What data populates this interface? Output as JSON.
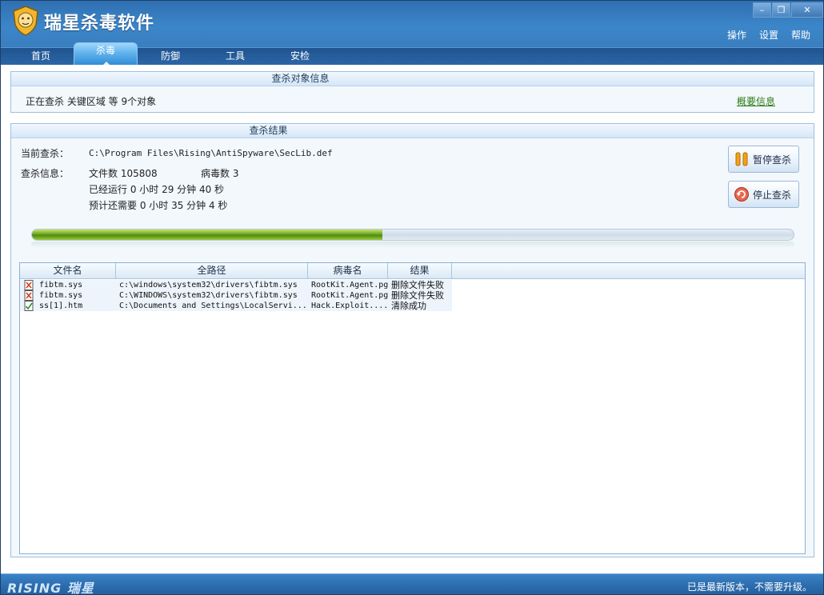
{
  "app": {
    "title": "瑞星杀毒软件"
  },
  "top_menu": {
    "ops": "操作",
    "settings": "设置",
    "help": "帮助"
  },
  "window_controls": {
    "minimize": "–",
    "restore": "❐",
    "close": "✕"
  },
  "tabs": [
    {
      "label": "首页"
    },
    {
      "label": "杀毒"
    },
    {
      "label": "防御"
    },
    {
      "label": "工具"
    },
    {
      "label": "安检"
    }
  ],
  "target_panel": {
    "title": "查杀对象信息",
    "status": "正在查杀 关键区域 等 9个对象",
    "summary_link": "概要信息"
  },
  "result_panel": {
    "title": "查杀结果",
    "current_label": "当前查杀：",
    "current_path": "C:\\Program Files\\Rising\\AntiSpyware\\SecLib.def",
    "info_label": "查杀信息：",
    "file_count_text": "文件数 105808",
    "virus_count_text": "病毒数 3",
    "elapsed_text": "已经运行 0 小时 29 分钟 40  秒",
    "remaining_text": "预计还需要 0 小时 35 分钟 4  秒",
    "progress_fraction": 0.46,
    "pause_button": "暂停查杀",
    "stop_button": "停止查杀"
  },
  "table": {
    "headers": [
      "文件名",
      "全路径",
      "病毒名",
      "结果"
    ],
    "rows": [
      {
        "name": "fibtm.sys",
        "path": "c:\\windows\\system32\\drivers\\fibtm.sys",
        "virus": "RootKit.Agent.pg",
        "result": "删除文件失败"
      },
      {
        "name": "fibtm.sys",
        "path": "C:\\WINDOWS\\system32\\drivers\\fibtm.sys",
        "virus": "RootKit.Agent.pg",
        "result": "删除文件失败"
      },
      {
        "name": "ss[1].htm",
        "path": "C:\\Documents and Settings\\LocalServi...",
        "virus": "Hack.Exploit....",
        "result": "清除成功"
      }
    ]
  },
  "footer": {
    "brand": "RISING 瑞星",
    "status": "已是最新版本，不需要升级。"
  },
  "colors": {
    "header": "#3b86c9",
    "progress": "#6aa420",
    "link": "#2b7a12"
  }
}
